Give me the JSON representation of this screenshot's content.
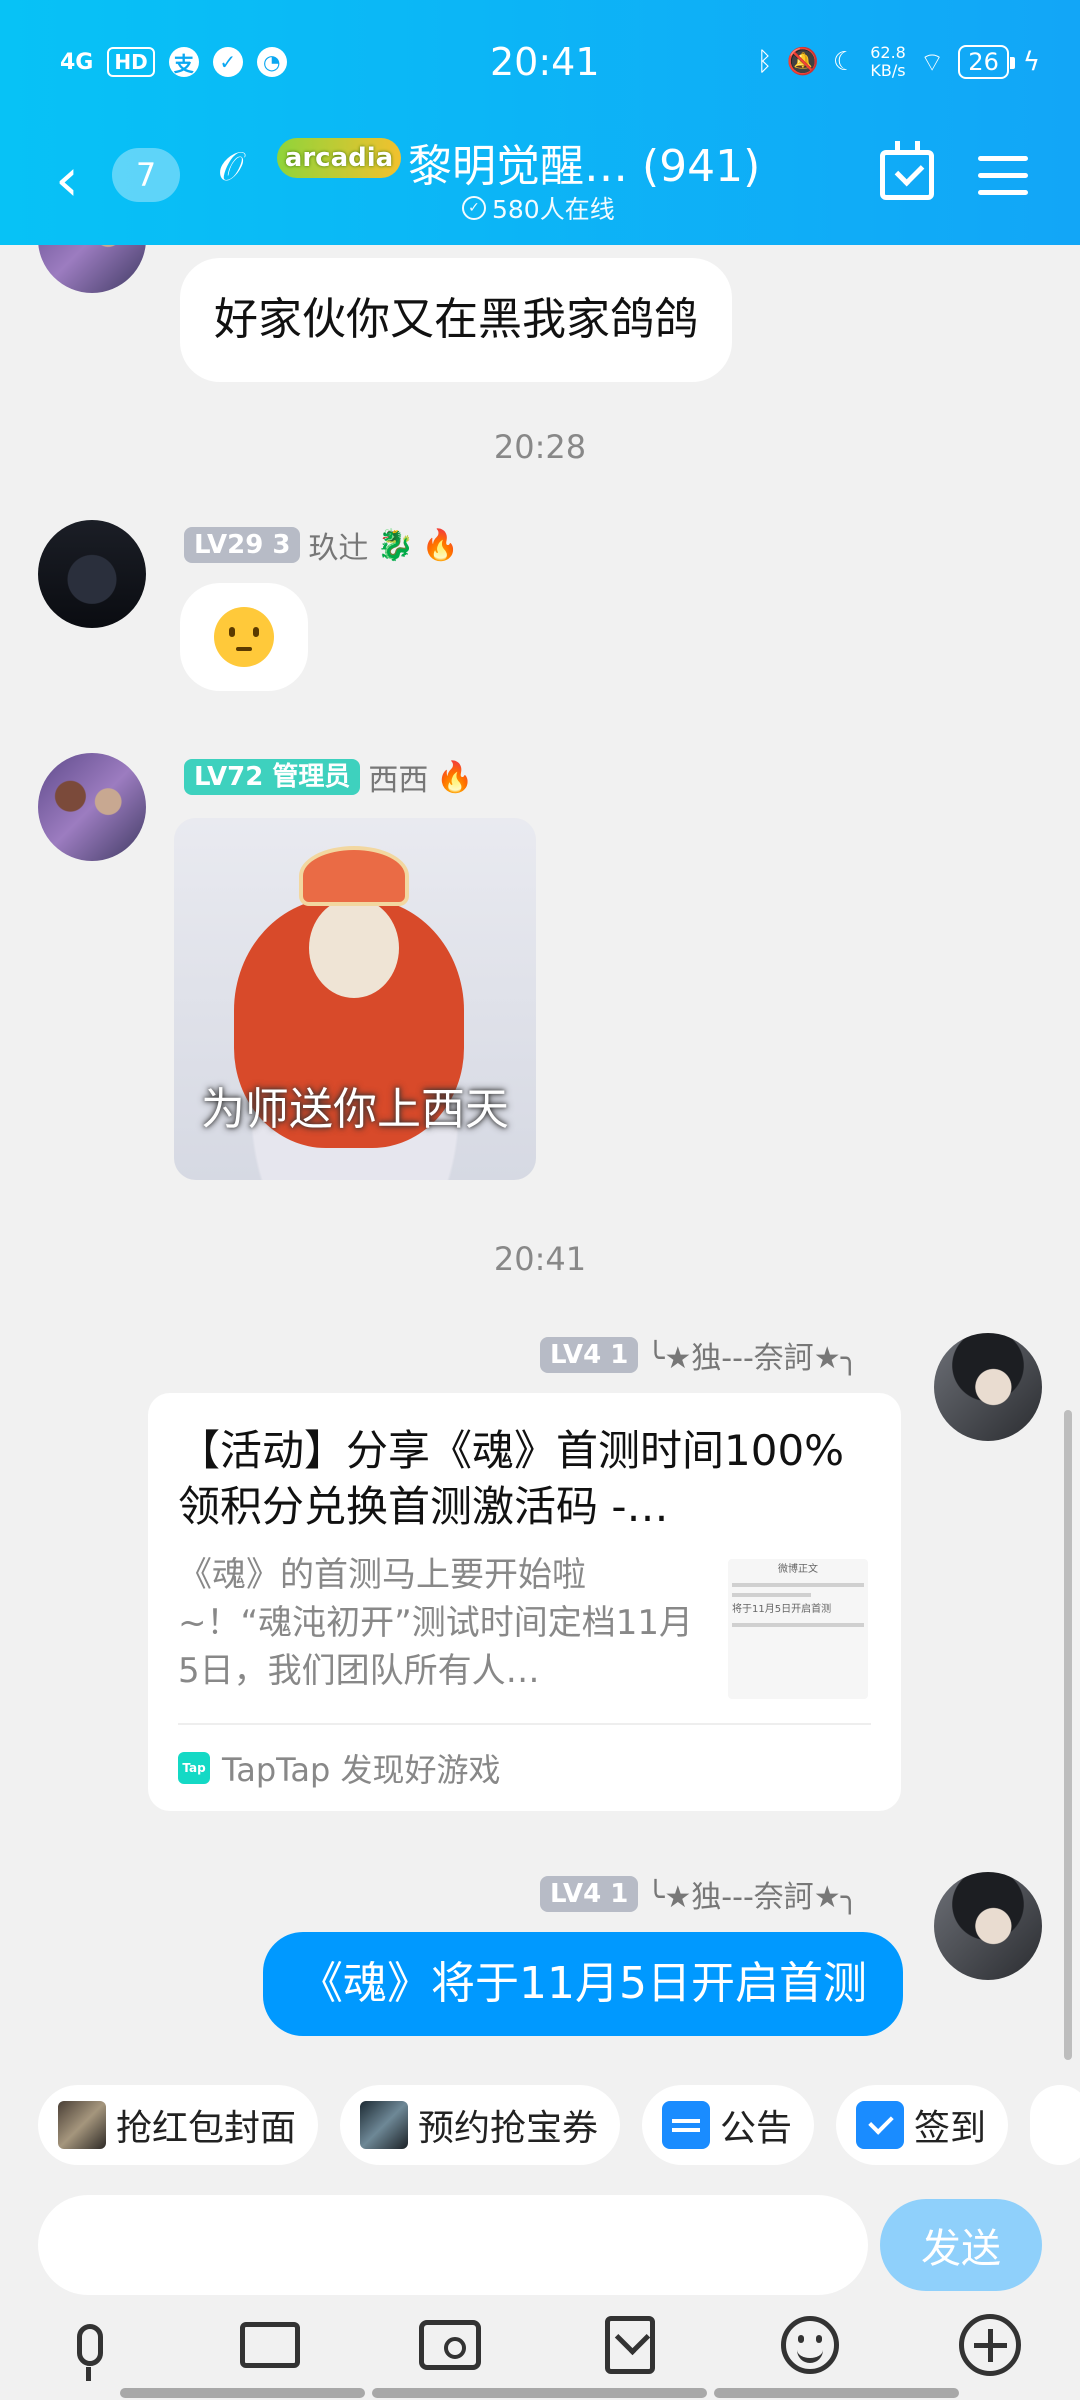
{
  "status_bar": {
    "network": "4G",
    "hd": "HD",
    "time": "20:41",
    "speed_value": "62.8",
    "speed_unit": "KB/s",
    "battery": "26"
  },
  "header": {
    "back_count": "7",
    "logo_text": "arcadia",
    "title": "黎明觉醒…  (941)",
    "online": "580人在线"
  },
  "messages": [
    {
      "text": "好家伙你又在黑我家鸽鸽"
    },
    {
      "time": "20:28"
    },
    {
      "level": "LV29 3",
      "name": "玖辻",
      "content": "emoji-angry"
    },
    {
      "level": "LV72",
      "role": "管理员",
      "name": "西西",
      "sticker_caption": "为师送你上西天"
    },
    {
      "time": "20:41"
    },
    {
      "level": "LV4 1",
      "name": "╰★独---奈訶★╮",
      "card": {
        "title": "【活动】分享《魂》首测时间100%领积分兑换首测激活码 -…",
        "desc": "《魂》的首测马上要开始啦~！“魂沌初开”测试时间定档11月5日，我们团队所有人…",
        "source": "TapTap 发现好游戏",
        "thumb_title": "微博正文",
        "thumb_line": "将于11月5日开启首测"
      }
    },
    {
      "level": "LV4 1",
      "name": "╰★独---奈訶★╮",
      "text": "《魂》将于11月5日开启首测"
    }
  ],
  "quick_actions": [
    "抢红包封面",
    "预约抢宝券",
    "公告",
    "签到"
  ],
  "input": {
    "placeholder": "",
    "send_label": "发送"
  },
  "toolbar": [
    "mic-icon",
    "cast-icon",
    "camera-icon",
    "album-icon",
    "emoji-icon",
    "plus-icon"
  ]
}
